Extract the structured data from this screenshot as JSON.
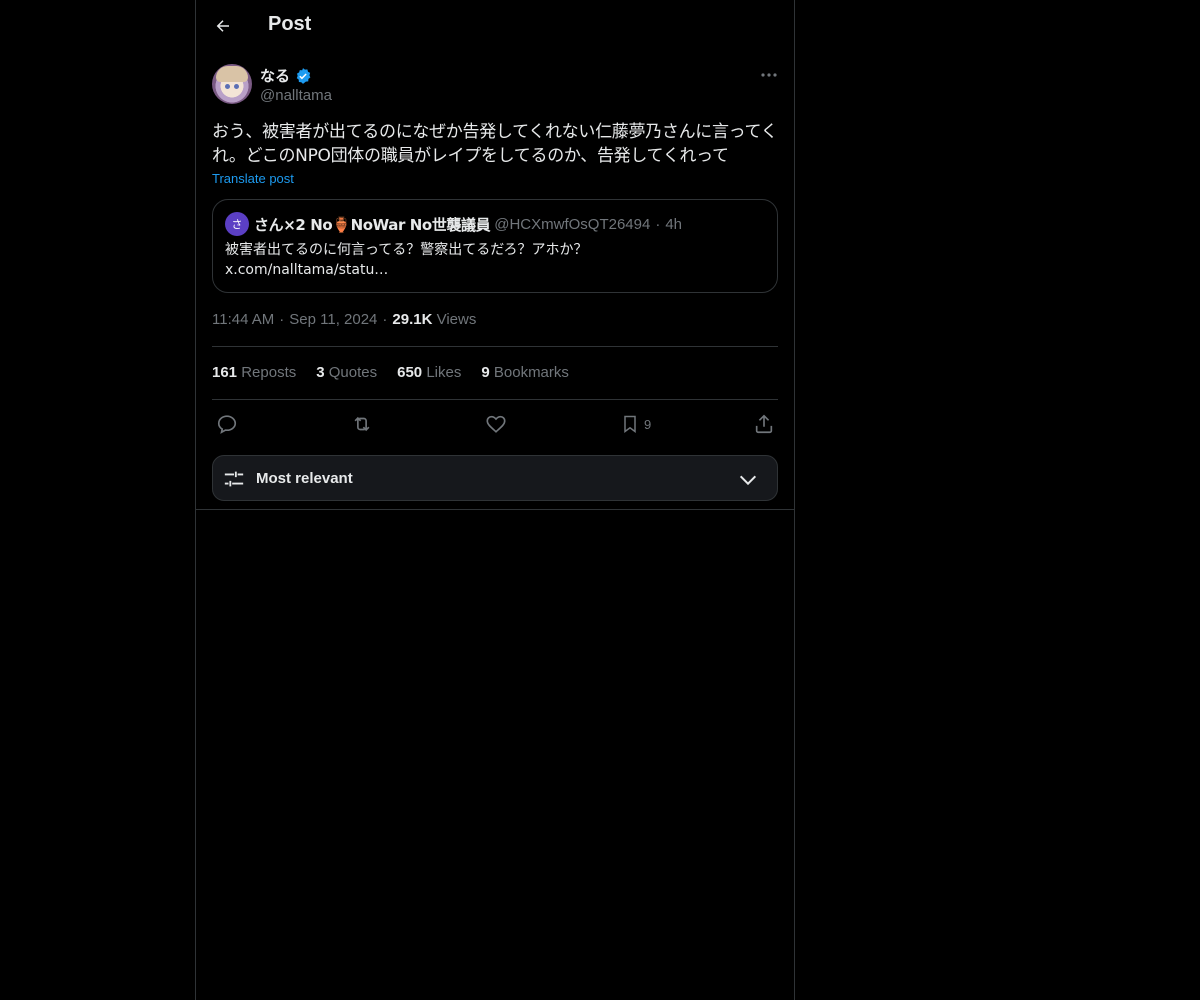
{
  "header": {
    "title": "Post"
  },
  "author": {
    "name": "なる",
    "handle": "@nalltama",
    "verified": true
  },
  "post": {
    "text": "おう、被害者が出てるのになぜか告発してくれない仁藤夢乃さんに言ってくれ。どこのNPO団体の職員がレイプをしてるのか、告発してくれって",
    "translate_label": "Translate post",
    "time": "11:44 AM",
    "date": "Sep 11, 2024",
    "views_count": "29.1K",
    "views_label": "Views"
  },
  "quote": {
    "avatar_letter": "さ",
    "name": "さん×2 No🏺NoWar No世襲議員",
    "handle": "@HCXmwfOsQT26494",
    "time": "4h",
    "text_line1": "被害者出てるのに何言ってる？警察出てるだろ？アホか？",
    "text_line2": "x.com/nalltama/statu…"
  },
  "stats": {
    "reposts_count": "161",
    "reposts_label": "Reposts",
    "quotes_count": "3",
    "quotes_label": "Quotes",
    "likes_count": "650",
    "likes_label": "Likes",
    "bookmarks_count": "9",
    "bookmarks_label": "Bookmarks"
  },
  "actions": {
    "bookmark_count": "9"
  },
  "sort": {
    "label": "Most relevant"
  },
  "icons": {
    "back": "arrow-left-icon",
    "more": "more-horizontal-icon",
    "verified": "verified-badge-icon",
    "reply": "reply-icon",
    "repost": "repost-icon",
    "like": "heart-icon",
    "bookmark": "bookmark-icon",
    "share": "share-icon",
    "sort": "sliders-icon",
    "chevron": "chevron-down-icon"
  },
  "colors": {
    "background": "#000000",
    "text": "#e7e9ea",
    "muted": "#71767b",
    "accent": "#1d9bf0",
    "border": "#2f3336"
  }
}
